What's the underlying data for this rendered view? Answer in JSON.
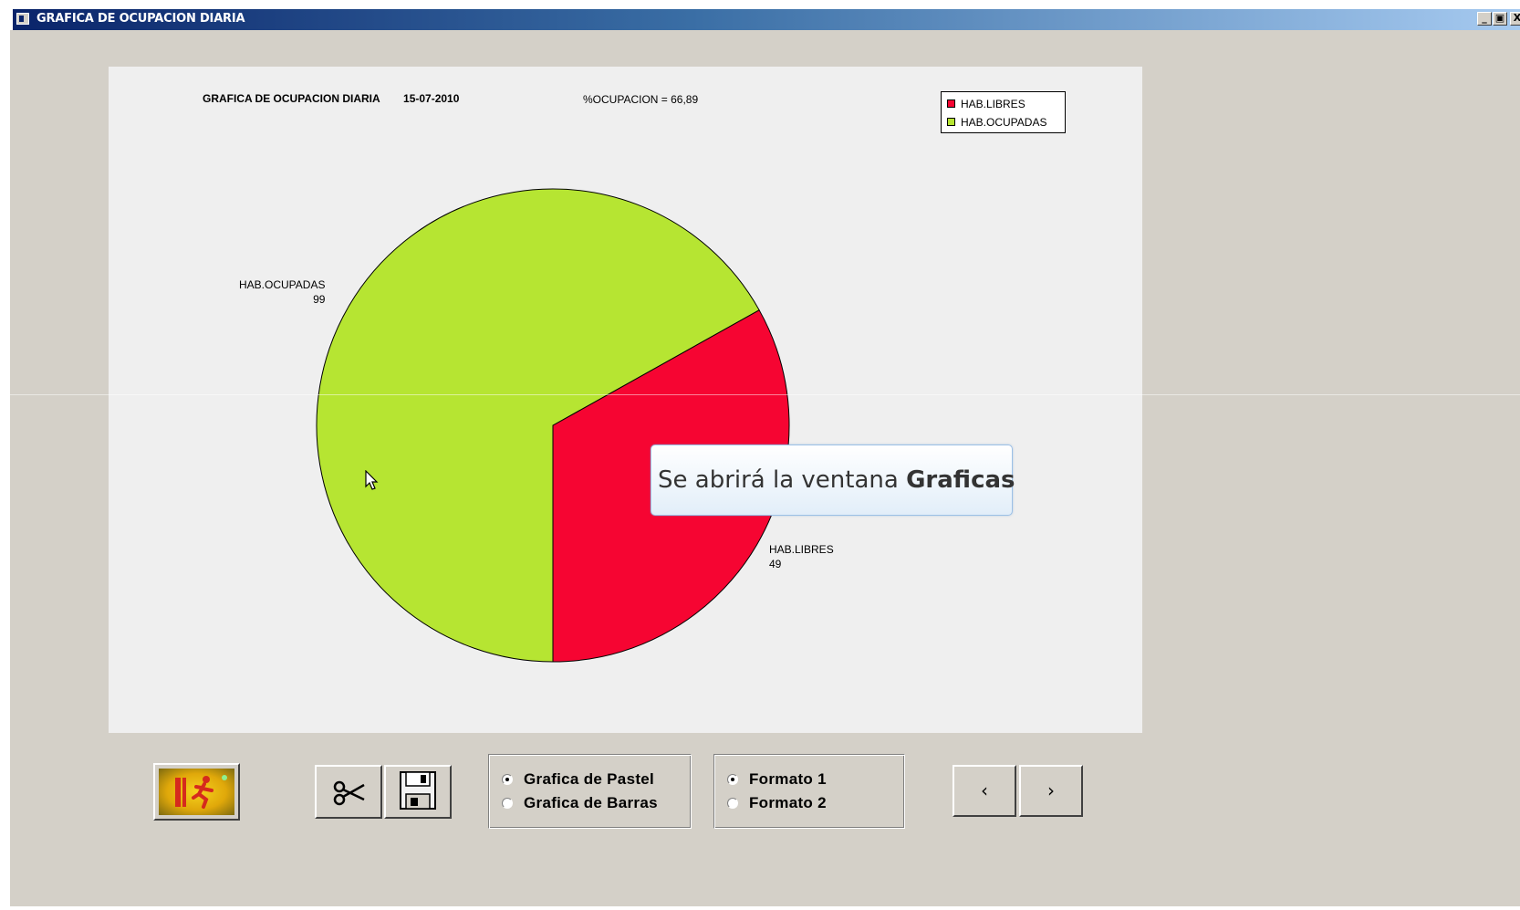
{
  "window": {
    "title": "GRAFICA DE OCUPACION DIARIA",
    "minimize_label": "_",
    "restore_label": "▣",
    "close_label": "X"
  },
  "chart_header": {
    "title": "GRAFICA DE OCUPACION DIARIA",
    "date": "15-07-2010",
    "ocupacion": "%OCUPACION  =  66,89"
  },
  "chart_data": {
    "type": "pie",
    "title": "GRAFICA DE OCUPACION DIARIA",
    "subtitle": "15-07-2010",
    "legend_position": "top-right",
    "slices": [
      {
        "label": "HAB.LIBRES",
        "value": 49,
        "color": "#f60532"
      },
      {
        "label": "HAB.OCUPADAS",
        "value": 99,
        "color": "#b6e532"
      }
    ]
  },
  "legend": {
    "items": [
      {
        "label": "HAB.LIBRES",
        "color": "#f60532"
      },
      {
        "label": "HAB.OCUPADAS",
        "color": "#b6e532"
      }
    ]
  },
  "slice_labels": {
    "ocupadas_name": "HAB.OCUPADAS",
    "ocupadas_value": "99",
    "libres_name": "HAB.LIBRES",
    "libres_value": "49"
  },
  "tooltip": {
    "text_prefix": "Se abrirá la ventana ",
    "text_bold": "Graficas"
  },
  "chart_type_options": {
    "options": [
      {
        "label": "Grafica de Pastel",
        "selected": true
      },
      {
        "label": "Grafica de Barras",
        "selected": false
      }
    ]
  },
  "format_options": {
    "options": [
      {
        "label": "Formato 1",
        "selected": true
      },
      {
        "label": "Formato 2",
        "selected": false
      }
    ]
  },
  "nav": {
    "prev_label": "‹",
    "next_label": "›"
  },
  "icons": {
    "exit": "exit-door-icon",
    "cut": "scissors-icon",
    "save": "floppy-disk-icon"
  }
}
